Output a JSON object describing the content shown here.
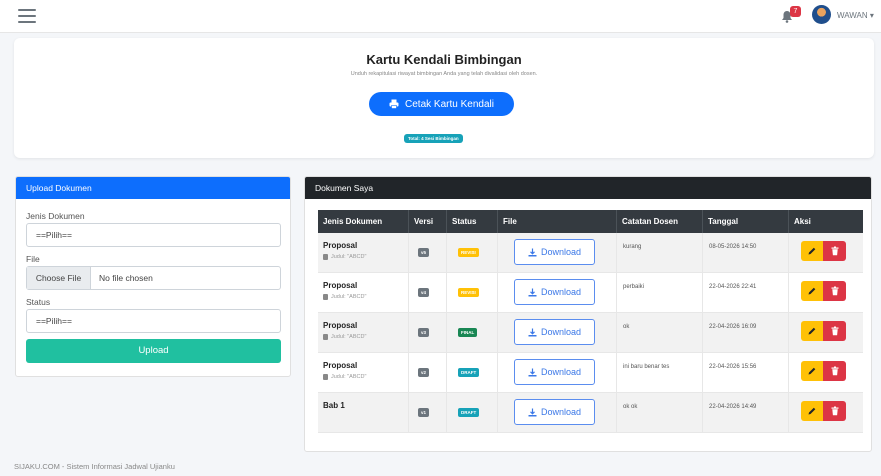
{
  "topbar": {
    "notification_count": "7",
    "user_name": "WAWAN",
    "icons": [
      "menu-icon",
      "bell-icon",
      "avatar",
      "caret-down-icon"
    ]
  },
  "kartu": {
    "title": "Kartu Kendali Bimbingan",
    "description": "Unduh rekapitulasi riwayat bimbingan Anda yang telah divalidasi oleh dosen.",
    "button_label": "Cetak Kartu Kendali",
    "badge": "Total: 4 Sesi Bimbingan"
  },
  "upload": {
    "header": "Upload Dokumen",
    "jenis_label": "Jenis Dokumen",
    "jenis_value": "==Pilih==",
    "file_label": "File",
    "file_button": "Choose File",
    "file_value": "No file chosen",
    "status_label": "Status",
    "status_value": "==Pilih==",
    "submit_label": "Upload"
  },
  "dokumen": {
    "header": "Dokumen Saya",
    "columns": [
      "Jenis Dokumen",
      "Versi",
      "Status",
      "File",
      "Catatan Dosen",
      "Tanggal",
      "Aksi"
    ],
    "download_label": "Download",
    "rows": [
      {
        "jenis": "Proposal",
        "judul": "Judul: \"ABCD\"",
        "versi": "v5",
        "status": "REVISI",
        "status_color": "#ffc107",
        "catatan": "kurang",
        "tanggal": "08-05-2026 14:50"
      },
      {
        "jenis": "Proposal",
        "judul": "Judul: \"ABCD\"",
        "versi": "v4",
        "status": "REVISI",
        "status_color": "#ffc107",
        "catatan": "perbaiki",
        "tanggal": "22-04-2026 22:41"
      },
      {
        "jenis": "Proposal",
        "judul": "Judul: \"ABCD\"",
        "versi": "v3",
        "status": "FINAL",
        "status_color": "#198754",
        "catatan": "ok",
        "tanggal": "22-04-2026 16:09"
      },
      {
        "jenis": "Proposal",
        "judul": "Judul: \"ABCD\"",
        "versi": "v2",
        "status": "DRAFT",
        "status_color": "#17a2b8",
        "catatan": "ini baru benar tes",
        "tanggal": "22-04-2026 15:56"
      },
      {
        "jenis": "Bab 1",
        "judul": "",
        "versi": "v1",
        "status": "DRAFT",
        "status_color": "#17a2b8",
        "catatan": "ok ok",
        "tanggal": "22-04-2026 14:49"
      }
    ]
  },
  "footer": {
    "text": "SIJAKU.COM - Sistem Informasi Jadwal Ujianku"
  }
}
